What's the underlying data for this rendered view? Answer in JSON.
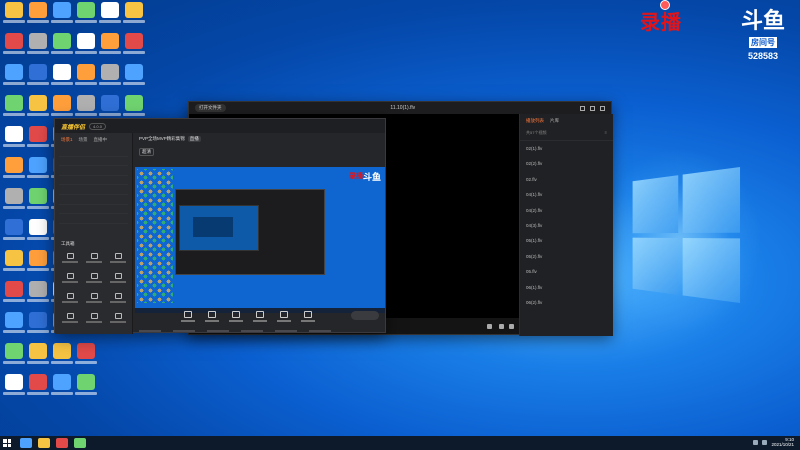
{
  "watermark": {
    "recording_text": "录播",
    "douyu_logo": "斗鱼",
    "room_label": "房间号",
    "room_number": "528583"
  },
  "player": {
    "title": "11.10(1).flv",
    "top_left_pill": "打开文件夹",
    "playlist_tabs": [
      "播放列表",
      "片库"
    ],
    "playlist_sub": "共57个视频",
    "playlist_items": [
      "02(1).flv",
      "02(2).flv",
      "02.flv",
      "04(1).flv",
      "04(2).flv",
      "04(3).flv",
      "05(1).flv",
      "05(2).flv",
      "05.flv",
      "06(1).flv",
      "06(2).flv"
    ]
  },
  "live": {
    "brand": "直播伴侣",
    "version": "4.0.0",
    "side_tabs": [
      "场景1",
      "场景",
      "直播中"
    ],
    "tools_label": "工具箱",
    "stream_title": "PVP全场MVP精彩集锦",
    "stream_tag": "直播",
    "quality_badge": "超清"
  },
  "colors": {
    "accent": "#ff7a3c",
    "desktop": "#0b5fd0",
    "record_red": "#e0141b"
  },
  "taskbar": {
    "time": "9:10",
    "date": "2021/10/21"
  }
}
